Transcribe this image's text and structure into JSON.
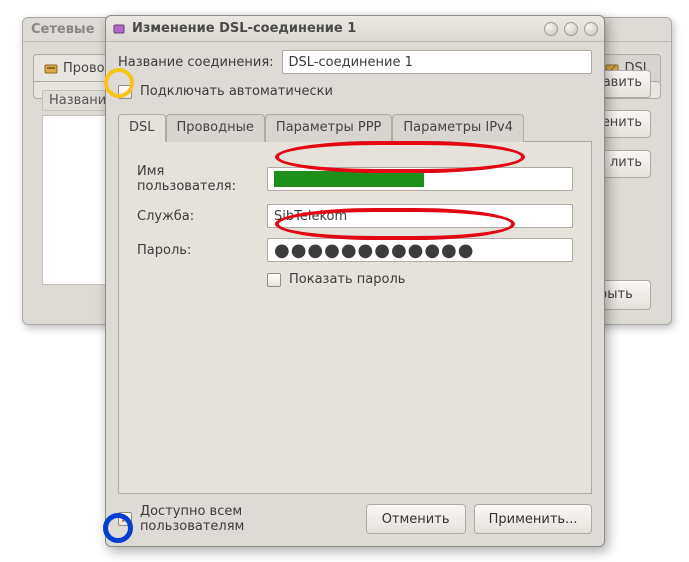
{
  "bg_window": {
    "title": "Сетевые",
    "tab_left": "Провод",
    "tab_right": "DSL",
    "column_header": "Название",
    "buttons": {
      "add": "авить",
      "edit": "енить",
      "delete": "лить"
    },
    "close": "крыть"
  },
  "dialog": {
    "title": "Изменение DSL-соединение 1",
    "name_label": "Название соединения:",
    "name_value": "DSL-соединение 1",
    "auto_connect": {
      "checked": false,
      "label": "Подключать автоматически"
    },
    "tabs": [
      "DSL",
      "Проводные",
      "Параметры PPP",
      "Параметры IPv4"
    ],
    "active_tab": 0,
    "dsl_form": {
      "username_label": "Имя пользователя:",
      "username_value": "",
      "service_label": "Служба:",
      "service_value": "SibTelekom",
      "password_label": "Пароль:",
      "password_value": "●●●●●●●●●●●●",
      "show_password": {
        "checked": false,
        "label": "Показать пароль"
      }
    },
    "all_users": {
      "checked": true,
      "label": "Доступно всем пользователям"
    },
    "buttons": {
      "cancel": "Отменить",
      "apply": "Применить..."
    }
  }
}
